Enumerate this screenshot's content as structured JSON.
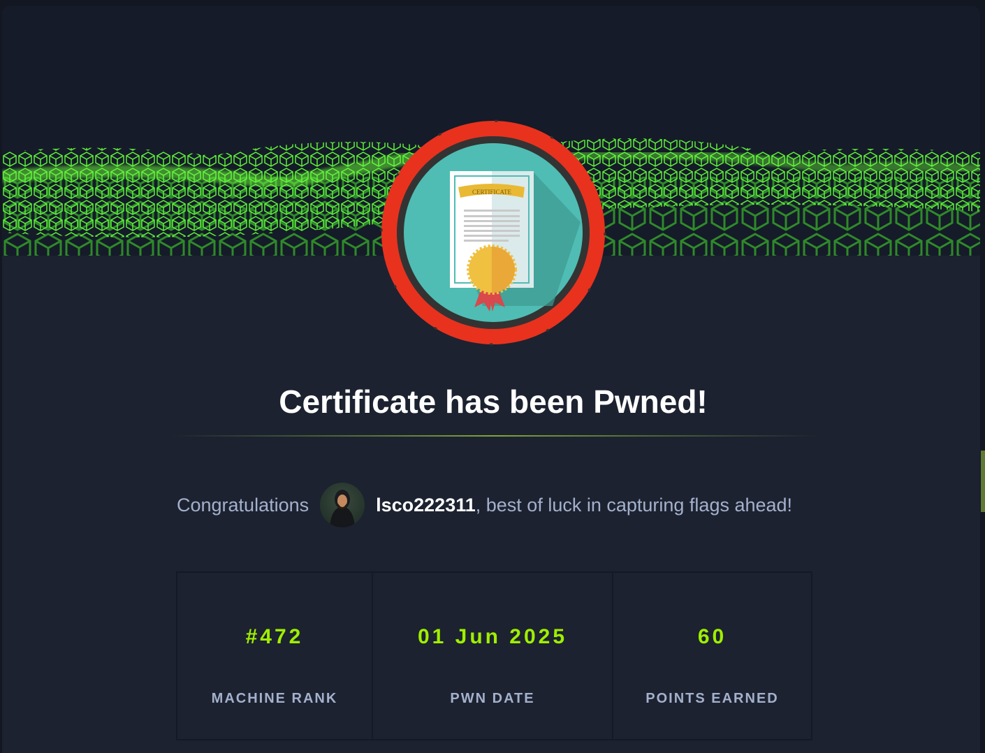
{
  "badge": {
    "text": "CERTIFICATE",
    "ring_color": "#e8321e",
    "inner_color": "#4fbdb3"
  },
  "title": "Certificate has been Pwned!",
  "congrats": {
    "prefix": "Congratulations",
    "username": "lsco222311",
    "suffix": ", best of luck in capturing flags ahead!"
  },
  "stats": [
    {
      "value": "#472",
      "label": "MACHINE RANK"
    },
    {
      "value": "01 Jun 2025",
      "label": "PWN DATE"
    },
    {
      "value": "60",
      "label": "POINTS EARNED"
    }
  ],
  "colors": {
    "accent": "#9fef00",
    "background": "#1c2230",
    "text_muted": "#a4b1cd"
  }
}
